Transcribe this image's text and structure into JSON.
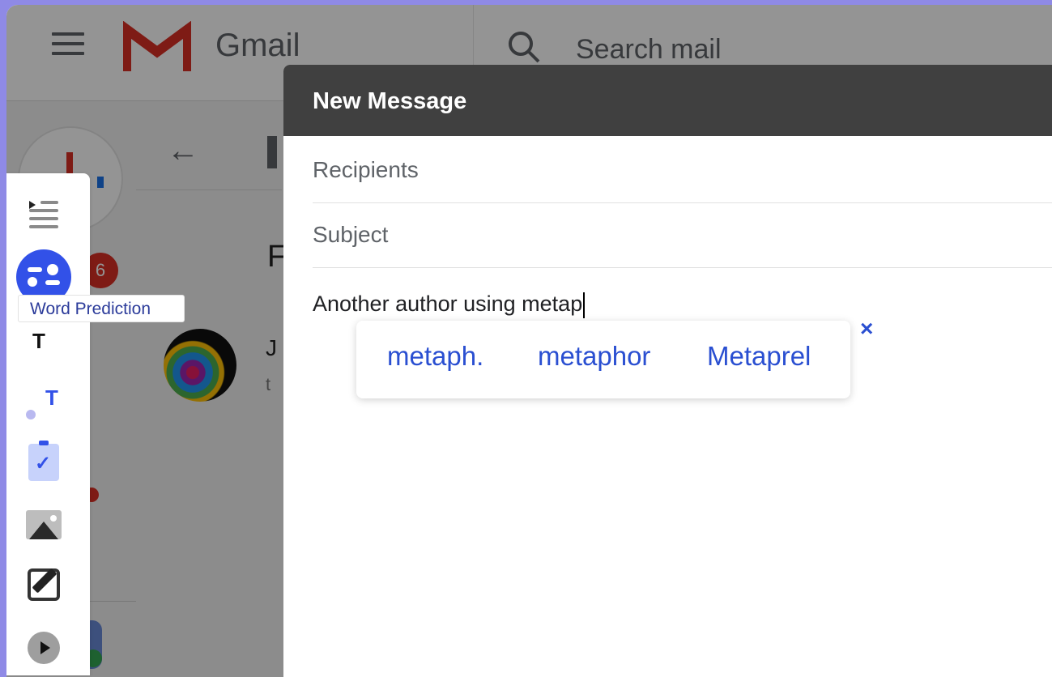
{
  "gmail": {
    "brand": "Gmail",
    "search_placeholder": "Search mail",
    "unread_badge": "6",
    "fragment_r": "F",
    "fragment_j": "J",
    "fragment_t": "t"
  },
  "compose": {
    "title": "New Message",
    "recipients_placeholder": "Recipients",
    "subject_placeholder": "Subject",
    "body_text": "Another author using metap"
  },
  "suggestions": {
    "items": [
      "metaph.",
      "metaphor",
      "Metaprel"
    ],
    "close_symbol": "×"
  },
  "toolbar": {
    "tooltip": "Word Prediction",
    "text_tool_1": "T",
    "text_tool_2": "T",
    "clip_check": "✓"
  },
  "colors": {
    "accent": "#3251e8",
    "suggestion_text": "#2a4fd1",
    "compose_header": "#404040",
    "background": "#8f8ae6"
  },
  "icons": [
    "hamburger-icon",
    "gmail-logo-icon",
    "search-icon",
    "back-arrow-icon",
    "list-icon",
    "word-prediction-icon",
    "text-icon",
    "clipboard-check-icon",
    "image-icon",
    "edit-icon",
    "play-icon",
    "close-icon"
  ]
}
